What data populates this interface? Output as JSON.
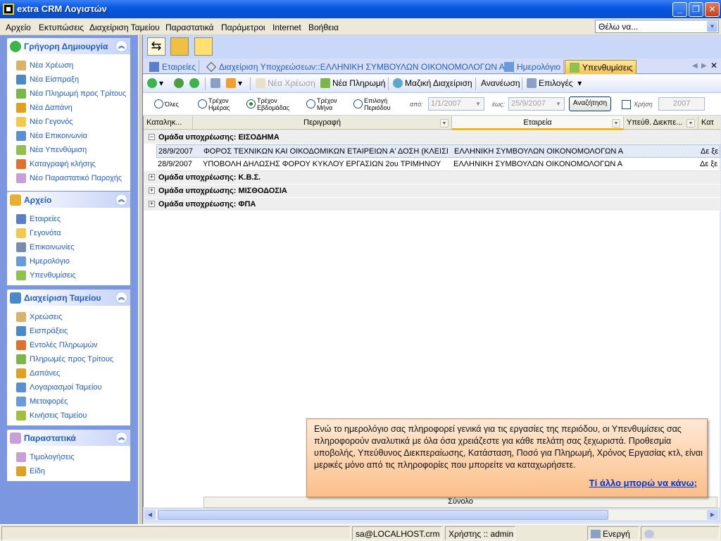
{
  "window": {
    "title": "extra CRM Λογιστών"
  },
  "menu": [
    "Αρχείο",
    "Εκτυπώσεις",
    "Διαχείριση Ταμείου",
    "Παραστατικά",
    "Παράμετροι",
    "Internet",
    "Βοήθεια"
  ],
  "search": {
    "value": "Θέλω να..."
  },
  "sidebar": {
    "quick": {
      "title": "Γρήγορη Δημιουργία",
      "items": [
        "Νέα Χρέωση",
        "Νέα Είσπραξη",
        "Νέα Πληρωμή προς Τρίτους",
        "Νέα Δαπάνη",
        "Νέο Γεγονός",
        "Νέα Επικοινωνία",
        "Νέα Υπενθύμιση",
        "Καταγραφή κλήσης",
        "Νέο Παραστατικό Παροχής"
      ]
    },
    "archive": {
      "title": "Αρχείο",
      "items": [
        "Εταιρείες",
        "Γεγονότα",
        "Επικοινωνίες",
        "Ημερολόγιο",
        "Υπενθυμίσεις"
      ]
    },
    "cash": {
      "title": "Διαχείριση Ταμείου",
      "items": [
        "Χρεώσεις",
        "Εισπράξεις",
        "Εντολές Πληρωμών",
        "Πληρωμές προς Τρίτους",
        "Δαπάνες",
        "Λογαριασμοί Ταμείου",
        "Μεταφορές",
        "Κινήσεις Ταμείου"
      ]
    },
    "docs": {
      "title": "Παραστατικά",
      "items": [
        "Τιμολογήσεις",
        "Είδη"
      ]
    }
  },
  "tabs": [
    "Εταιρείες",
    "Διαχείριση Υποχρεώσεων::ΕΛΛΗΝΙΚΗ ΣΥΜΒΟΥΛΩΝ ΟΙΚΟΝΟΜΟΛΟΓΩΝ ΑΕ",
    "Ημερολόγιο",
    "Υπενθυμίσεις"
  ],
  "toolbar": {
    "new_charge": "Νέα Χρέωση",
    "new_payment": "Νέα Πληρωμή",
    "bulk": "Μαζική Διαχείριση",
    "refresh": "Ανανέωση",
    "options": "Επιλογές"
  },
  "filters": {
    "all": "Όλες",
    "day_1": "Τρέχον",
    "day_2": "Ημέρας",
    "week_1": "Τρέχον",
    "week_2": "Εβδομάδας",
    "month_1": "Τρέχον",
    "month_2": "Μήνα",
    "period_1": "Επιλογή",
    "period_2": "Περιόδου",
    "from_label": "από:",
    "from_value": "1/1/2007",
    "to_label": "έως:",
    "to_value": "25/9/2007",
    "search_button": "Αναζήτηση",
    "year_label": "Χρήση",
    "year_value": "2007"
  },
  "grid": {
    "columns": [
      "Καταληκ...",
      "Περιγραφή",
      "Εταιρεία",
      "Υπεύθ. Διεκπε...",
      "Κατ"
    ],
    "groups": [
      {
        "label": "Ομάδα υποχρέωσης: ΕΙΣΟΔΗΜΑ",
        "expander": "−"
      },
      {
        "label": "Ομάδα υποχρέωσης: Κ.Β.Σ.",
        "expander": "+"
      },
      {
        "label": "Ομάδα υποχρέωσης: ΜΙΣΘΟΔΟΣΙΑ",
        "expander": "+"
      },
      {
        "label": "Ομάδα υποχρέωσης: ΦΠΑ",
        "expander": "+"
      }
    ],
    "rows": [
      {
        "date": "28/9/2007",
        "desc": "ΦΟΡΟΣ ΤΕΧΝΙΚΩΝ ΚΑΙ ΟΙΚΟΔΟΜΙΚΩΝ ΕΤΑΙΡΕΙΩΝ Α' ΔΟΣΗ (ΚΛΕΙΣΙΜ...",
        "company": "ΕΛΛΗΝΙΚΗ ΣΥΜΒΟΥΛΩΝ ΟΙΚΟΝΟΜΟΛΟΓΩΝ ΑΕ",
        "status": "Δε ξε"
      },
      {
        "date": "28/9/2007",
        "desc": "ΥΠΟΒΟΛΗ ΔΗΛΩΣΗΣ ΦΟΡΟΥ ΚΥΚΛΟΥ ΕΡΓΑΣΙΩΝ 2ου ΤΡΙΜΗΝΟΥ",
        "company": "ΕΛΛΗΝΙΚΗ ΣΥΜΒΟΥΛΩΝ ΟΙΚΟΝΟΜΟΛΟΓΩΝ ΑΕ",
        "status": "Δε ξε"
      }
    ],
    "totals_label": "Σύνολο"
  },
  "tooltip": {
    "text": "Ενώ το ημερολόγιο σας πληροφορεί γενικά για τις εργασίες της περιόδου, οι Υπενθυμίσεις σας πληροφορούν αναλυτικά με όλα όσα χρειάζεστε για κάθε πελάτη σας ξεχωριστά. Προθεσμία υποβολής, Υπεύθυνος Διεκπεραίωσης, Κατάσταση, Ποσό για Πληρωμή, Χρόνος Εργασίας κτλ, είναι μερικές μόνο από τις πληροφορίες που μπορείτε να καταχωρήσετε.",
    "link": "Τί άλλο μπορώ να κάνω;"
  },
  "status": {
    "server": "sa@LOCALHOST.crm",
    "user": "Χρήστης :: admin",
    "state": "Ενεργή"
  },
  "colors": {
    "accent": "#215dc6",
    "sidebar": "#7b97e0",
    "active_tab": "#f8c44a"
  }
}
